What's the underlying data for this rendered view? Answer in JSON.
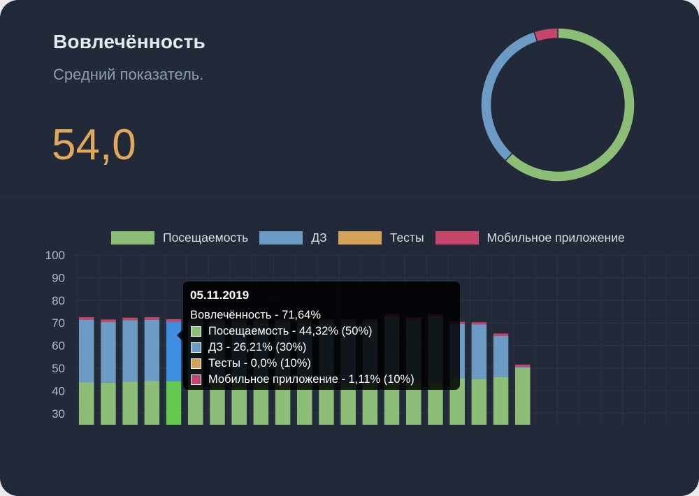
{
  "widget": {
    "title": "Вовлечённость",
    "subtitle": "Средний показатель.",
    "value": "54,0"
  },
  "colors": {
    "attendance": "#8dbe78",
    "homework": "#6c9cc6",
    "tests": "#d5a25a",
    "mobile": "#c5466a",
    "attendance_hover": "#63c94f",
    "homework_hover": "#3f8fe1",
    "accent_value": "#dfa85a"
  },
  "donut_data": {
    "type": "pie",
    "slices": [
      {
        "name": "Посещаемость",
        "value": 62,
        "color": "#8dbe78"
      },
      {
        "name": "ДЗ",
        "value": 33,
        "color": "#6c9cc6"
      },
      {
        "name": "Тесты",
        "value": 0,
        "color": "#d5a25a"
      },
      {
        "name": "Мобильное приложение",
        "value": 5,
        "color": "#c5466a"
      }
    ]
  },
  "chart_data": {
    "type": "bar",
    "stacked": true,
    "ylim": [
      25,
      100
    ],
    "yticks": [
      30,
      40,
      50,
      60,
      70,
      80,
      90,
      100
    ],
    "grid": true,
    "legend_placement": "top",
    "bar_count": 22,
    "highlighted_index": 4,
    "series": [
      {
        "name": "Посещаемость",
        "color": "#8dbe78",
        "values": [
          43.8,
          43.6,
          44.1,
          44.3,
          44.32,
          44.0,
          44.0,
          44.0,
          44.0,
          44.0,
          44.0,
          44.0,
          44.0,
          44.0,
          44.0,
          44.0,
          44.0,
          45.5,
          45.3,
          46.1,
          50.0
        ]
      },
      {
        "name": "ДЗ",
        "color": "#6c9cc6",
        "values": [
          27.6,
          26.8,
          27.1,
          27.1,
          26.21,
          26.5,
          26.5,
          26.5,
          26.5,
          26.5,
          26.5,
          26.5,
          26.5,
          26.5,
          28.8,
          27.4,
          29.0,
          24.0,
          24.0,
          18.1,
          0.6
        ]
      },
      {
        "name": "Тесты",
        "color": "#d5a25a",
        "values": [
          0,
          0,
          0,
          0,
          0.0,
          0,
          0,
          0,
          0,
          0,
          0,
          0,
          0,
          0,
          0,
          0,
          0,
          0,
          0,
          0,
          0
        ]
      },
      {
        "name": "Мобильное приложение",
        "color": "#c5466a",
        "values": [
          1.1,
          1.1,
          1.1,
          1.1,
          1.11,
          1.1,
          1.1,
          1.1,
          1.1,
          1.1,
          1.1,
          1.1,
          1.1,
          1.1,
          1.1,
          1.1,
          1.0,
          1.0,
          1.0,
          1.1,
          1.0
        ]
      }
    ]
  },
  "legend": [
    {
      "label": "Посещаемость",
      "color": "#8dbe78"
    },
    {
      "label": "ДЗ",
      "color": "#6c9cc6"
    },
    {
      "label": "Тесты",
      "color": "#d5a25a"
    },
    {
      "label": "Мобильное приложение",
      "color": "#c5466a"
    }
  ],
  "tooltip": {
    "date": "05.11.2019",
    "total": "Вовлечённость - 71,64%",
    "rows": [
      {
        "label": "Посещаемость - 44,32% (50%)",
        "color": "#8dbe78"
      },
      {
        "label": "ДЗ - 26,21% (30%)",
        "color": "#6c9cc6"
      },
      {
        "label": "Тесты - 0,0% (10%)",
        "color": "#d5a25a"
      },
      {
        "label": "Мобильное приложение - 1,11% (10%)",
        "color": "#c5466a"
      }
    ]
  }
}
